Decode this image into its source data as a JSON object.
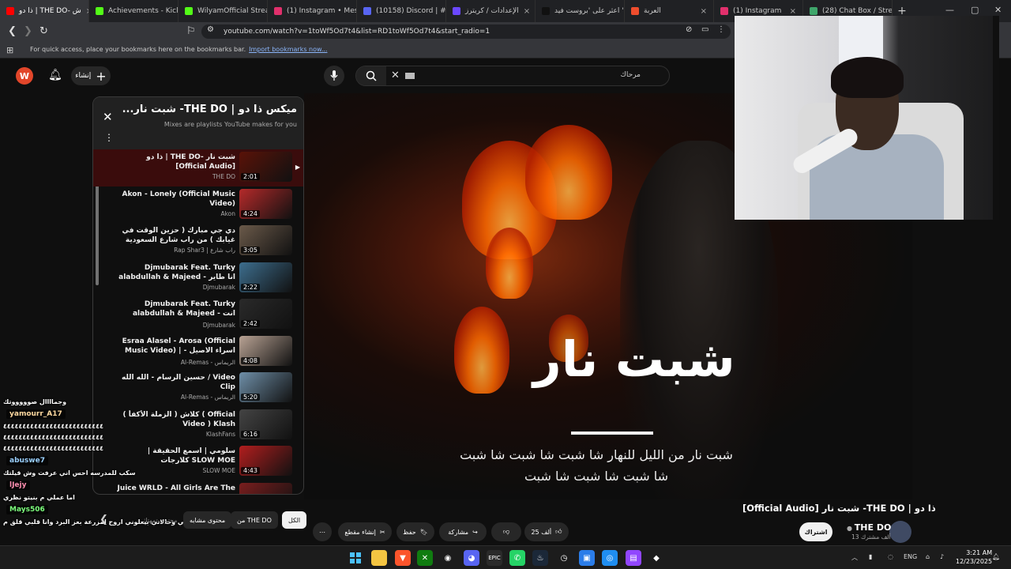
{
  "browser": {
    "tabs": [
      {
        "label": "ذا دو | THE DO- ش",
        "color": "#ff0000",
        "active": true
      },
      {
        "label": "Achievements - Kick D",
        "color": "#53fc18"
      },
      {
        "label": "WilyamOfficial Stream",
        "color": "#53fc18"
      },
      {
        "label": "(1) Instagram • Messa",
        "color": "#e1306c"
      },
      {
        "label": "(10158) Discord | #",
        "color": "#5865f2"
      },
      {
        "label": "الإعدادات / كريترز",
        "color": "#6b48ff"
      },
      {
        "label": "اعثر على 'بروست فيد '",
        "color": "#111111"
      },
      {
        "label": "العربة",
        "color": "#ee4d2d"
      },
      {
        "label": "(1) Instagram",
        "color": "#e1306c"
      },
      {
        "label": "(28) Chat Box / Stream",
        "color": "#3fa66b"
      }
    ],
    "url": "youtube.com/watch?v=1toWf5Od7t4&list=RD1toWf5Od7t4&start_radio=1",
    "bookmarks_msg": "For quick access, place your bookmarks here on the bookmarks bar.",
    "bookmarks_link": "Import bookmarks now..."
  },
  "yt_header": {
    "avatar_letter": "W",
    "create_label": "إنشاء",
    "search_value": "مرحاك"
  },
  "playlist": {
    "title": "ميكس ذا دو | THE DO- شبت نار...",
    "subtitle": "Mixes are playlists YouTube makes for you",
    "items": [
      {
        "title": "ذا دو | THE DO- شبت نار [Official Audio]",
        "channel": "THE DO",
        "duration": "2:01",
        "current": true,
        "thumb": "#5a1208"
      },
      {
        "title": "Akon - Lonely (Official Music Video)",
        "channel": "Akon",
        "duration": "4:24",
        "thumb": "#b52a2a"
      },
      {
        "title": "دي جي مبارك ( حزين الوقت في غيابك ) من راب شارع السعودية",
        "channel": "Rap Shar3 | راب شارع",
        "duration": "3:05",
        "thumb": "#6b5a4a"
      },
      {
        "title": "Djmubarak Feat. Turky alabdullah & Majeed - انا طاير",
        "channel": "Djmubarak",
        "duration": "2:22",
        "thumb": "#3d6e8e"
      },
      {
        "title": "Djmubarak Feat. Turky alabdullah & Majeed - انت مني",
        "channel": "Djmubarak",
        "duration": "2:42",
        "thumb": "#2a2a2a"
      },
      {
        "title": "Esraa Alasel - Arosa (Official Music Video) | اسراء الاصيل - عروسة",
        "channel": "Al-Remas - الريماس",
        "duration": "4:08",
        "thumb": "#b9a394"
      },
      {
        "title": "حسين الرسام - الله الله / Video Clip",
        "channel": "Al-Remas - الريماس",
        "duration": "5:20",
        "thumb": "#6f8fa8"
      },
      {
        "title": "كلاش ( الزملة الأكفأ ) ( Official Video ) Klash",
        "channel": "KlashFans",
        "duration": "6:16",
        "thumb": "#444444"
      },
      {
        "title": "سلومي | اسمع الحقيقة | كلارجات SLOW MOE",
        "channel": "SLOW MOE",
        "duration": "4:43",
        "thumb": "#b21e1e"
      },
      {
        "title": "Juice WRLD - All Girls Are The Same",
        "channel": "",
        "duration": "",
        "thumb": "#7a1e1e"
      }
    ]
  },
  "video": {
    "art_title": "شبت نار",
    "lyrics_line1": "شبت نار من الليل للنهار شا شبت شا شبت شا شبت",
    "lyrics_line2": "شا شبت شا شبت شا شبت",
    "title": "ذا دو | THE DO- شبت نار [Official Audio]",
    "channel": "THE DO",
    "subscribers": "13 ألف مشترك",
    "subscribe_label": "اشتراك",
    "likes": "25 ألف",
    "share_label": "مشاركة",
    "save_label": "حفظ",
    "clip_label": "إنشاء مقطع"
  },
  "chips": [
    {
      "label": "الكل",
      "selected": true
    },
    {
      "label": "من THE DO"
    },
    {
      "label": "محتوى مشابه"
    },
    {
      "label": "محتوى تمهتك"
    }
  ],
  "chat": [
    {
      "text": "وجماااال صوووووتك"
    },
    {
      "user": "yamourr_A17",
      "color": "#ffd9a0"
    },
    {
      "text": "٤٤٤٤٤٤٤٤٤٤٤٤٤٤٤٤٤٤٤٤٤٤٤٤٤٤"
    },
    {
      "text": "٤٤٤٤٤٤٤٤٤٤٤٤٤٤٤٤٤٤٤٤٤٤٤٤٤٤"
    },
    {
      "text": "٤٤٤٤٤٤٤٤٤٤٤٤٤٤٤٤٤٤٤٤٤٤٤٤٤٤"
    },
    {
      "user": "abuswe7",
      "color": "#9ad0ff"
    },
    {
      "text": "سكب للمدرسه احس اني عرفت وش قيلتك"
    },
    {
      "user": "lJejy",
      "color": "#ff8fb1"
    },
    {
      "text": "اما عملي م بنيتو نظري"
    },
    {
      "user": "Mays506",
      "color": "#7cff7c"
    },
    {
      "text": "ويلي تخيل امي وخالاتي بيعلوني اروح لمزرعة بعز البرد وانا قلبي قلق م"
    }
  ],
  "taskbar": {
    "lang": "ENG",
    "time": "3:21 AM",
    "date": "12/23/2025"
  }
}
